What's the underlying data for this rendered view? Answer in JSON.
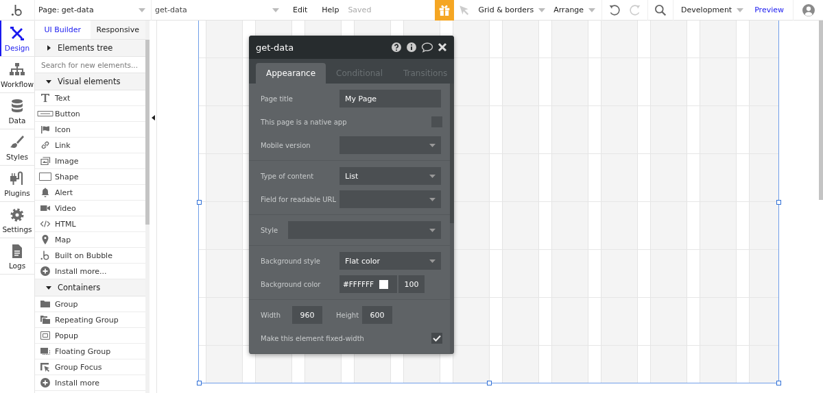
{
  "topbar": {
    "page_selector": "Page: get-data",
    "element_selector": "get-data",
    "menu": [
      {
        "label": "Edit"
      },
      {
        "label": "Help"
      }
    ],
    "save_status": "Saved",
    "tools": [
      {
        "label": "Grid & borders"
      },
      {
        "label": "Arrange"
      }
    ],
    "environment": "Development",
    "preview_link": "Preview"
  },
  "rail": [
    {
      "label": "Design",
      "selected": true
    },
    {
      "label": "Workflow",
      "selected": false
    },
    {
      "label": "Data",
      "selected": false
    },
    {
      "label": "Styles",
      "selected": false
    },
    {
      "label": "Plugins",
      "selected": false
    },
    {
      "label": "Settings",
      "selected": false
    },
    {
      "label": "Logs",
      "selected": false
    }
  ],
  "panel": {
    "tabs": [
      {
        "label": "UI Builder",
        "selected": true
      },
      {
        "label": "Responsive",
        "selected": false
      }
    ],
    "elements_tree": {
      "label": "Elements tree",
      "expanded": false
    },
    "search": {
      "placeholder": "Search for new elements..."
    },
    "sections": [
      {
        "label": "Visual elements",
        "expanded": true,
        "items": [
          "Text",
          "Button",
          "Icon",
          "Link",
          "Image",
          "Shape",
          "Alert",
          "Video",
          "HTML",
          "Map",
          "Built on Bubble",
          "Install more..."
        ]
      },
      {
        "label": "Containers",
        "expanded": true,
        "items": [
          "Group",
          "Repeating Group",
          "Popup",
          "Floating Group",
          "Group Focus",
          "Install more"
        ]
      }
    ]
  },
  "editor": {
    "title": "get-data",
    "tabs": [
      {
        "label": "Appearance",
        "selected": true
      },
      {
        "label": "Conditional",
        "selected": false
      },
      {
        "label": "Transitions",
        "selected": false
      }
    ],
    "groups": [
      [
        {
          "kind": "text",
          "label": "Page title",
          "value": "My Page"
        },
        {
          "kind": "checkbox",
          "label": "This page is a native app",
          "checked": false
        },
        {
          "kind": "dropdown",
          "label": "Mobile version"
        }
      ],
      [
        {
          "kind": "dropdown",
          "label": "Type of content",
          "value": "List"
        },
        {
          "kind": "dropdown",
          "label": "Field for readable URL"
        }
      ],
      [
        {
          "kind": "wide_dropdown",
          "label": "Style"
        }
      ],
      [
        {
          "kind": "dropdown",
          "label": "Background style",
          "value": "Flat color"
        },
        {
          "kind": "color",
          "label": "Background color",
          "value": "#FFFFFF",
          "opacity": "100"
        }
      ],
      [
        {
          "kind": "size",
          "label": "Width",
          "value": "960",
          "label_2": "Height",
          "value_2": "600"
        },
        {
          "kind": "checkbox",
          "label": "Make this element fixed-width",
          "checked": true
        }
      ]
    ]
  }
}
